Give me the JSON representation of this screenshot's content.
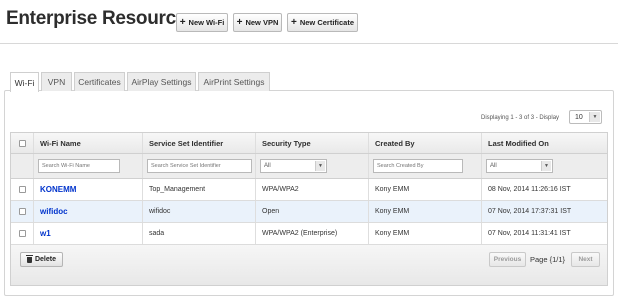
{
  "header": {
    "title": "Enterprise Resources",
    "buttons": [
      {
        "icon": "plus-icon",
        "label": "New Wi-Fi"
      },
      {
        "icon": "plus-icon",
        "label": "New VPN"
      },
      {
        "icon": "plus-icon",
        "label": "New Certificate"
      }
    ]
  },
  "tabs": [
    {
      "label": "Wi-Fi",
      "active": true
    },
    {
      "label": "VPN",
      "active": false
    },
    {
      "label": "Certificates",
      "active": false
    },
    {
      "label": "AirPlay Settings",
      "active": false
    },
    {
      "label": "AirPrint Settings",
      "active": false
    }
  ],
  "pagination_top": {
    "display_text": "Displaying 1 - 3 of 3  - Display",
    "page_size": "10"
  },
  "table": {
    "columns": [
      "Wi-Fi Name",
      "Service Set Identifier",
      "Security Type",
      "Created By",
      "Last Modified On"
    ],
    "filters": {
      "wifi_name_placeholder": "Search Wi-Fi Name",
      "ssid_placeholder": "Search Service Set Identifier",
      "security_type_value": "All",
      "created_by_placeholder": "Search Created By",
      "last_modified_value": "All"
    },
    "rows": [
      {
        "name": "KONEMM",
        "ssid": "Top_Management",
        "security": "WPA/WPA2",
        "created_by": "Kony EMM",
        "modified": "08 Nov, 2014 11:26:16 IST"
      },
      {
        "name": "wifidoc",
        "ssid": "wifidoc",
        "security": "Open",
        "created_by": "Kony EMM",
        "modified": "07 Nov, 2014 17:37:31 IST"
      },
      {
        "name": "w1",
        "ssid": "sada",
        "security": "WPA/WPA2 (Enterprise)",
        "created_by": "Kony EMM",
        "modified": "07 Nov, 2014 11:31:41 IST"
      }
    ]
  },
  "footer": {
    "delete_label": "Delete",
    "delete_icon": "trash-icon",
    "previous_label": "Previous",
    "page_label": "Page {1/1}",
    "next_label": "Next"
  },
  "colors": {
    "link": "#0033cc",
    "highlight_row": "#eaf2fb"
  }
}
